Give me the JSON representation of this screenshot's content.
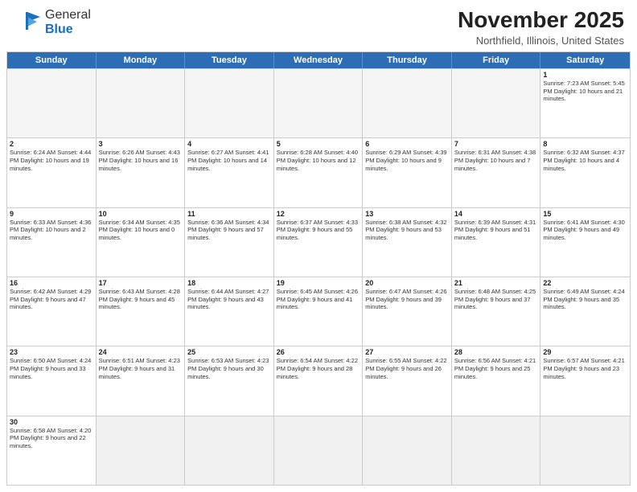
{
  "header": {
    "logo_general": "General",
    "logo_blue": "Blue",
    "month_title": "November 2025",
    "location": "Northfield, Illinois, United States"
  },
  "days_of_week": [
    "Sunday",
    "Monday",
    "Tuesday",
    "Wednesday",
    "Thursday",
    "Friday",
    "Saturday"
  ],
  "weeks": [
    [
      {
        "day": "",
        "info": "",
        "empty": true
      },
      {
        "day": "",
        "info": "",
        "empty": true
      },
      {
        "day": "",
        "info": "",
        "empty": true
      },
      {
        "day": "",
        "info": "",
        "empty": true
      },
      {
        "day": "",
        "info": "",
        "empty": true
      },
      {
        "day": "",
        "info": "",
        "empty": true
      },
      {
        "day": "1",
        "info": "Sunrise: 7:23 AM\nSunset: 5:45 PM\nDaylight: 10 hours and 21 minutes.",
        "empty": false
      }
    ],
    [
      {
        "day": "2",
        "info": "Sunrise: 6:24 AM\nSunset: 4:44 PM\nDaylight: 10 hours and 19 minutes.",
        "empty": false
      },
      {
        "day": "3",
        "info": "Sunrise: 6:26 AM\nSunset: 4:43 PM\nDaylight: 10 hours and 16 minutes.",
        "empty": false
      },
      {
        "day": "4",
        "info": "Sunrise: 6:27 AM\nSunset: 4:41 PM\nDaylight: 10 hours and 14 minutes.",
        "empty": false
      },
      {
        "day": "5",
        "info": "Sunrise: 6:28 AM\nSunset: 4:40 PM\nDaylight: 10 hours and 12 minutes.",
        "empty": false
      },
      {
        "day": "6",
        "info": "Sunrise: 6:29 AM\nSunset: 4:39 PM\nDaylight: 10 hours and 9 minutes.",
        "empty": false
      },
      {
        "day": "7",
        "info": "Sunrise: 6:31 AM\nSunset: 4:38 PM\nDaylight: 10 hours and 7 minutes.",
        "empty": false
      },
      {
        "day": "8",
        "info": "Sunrise: 6:32 AM\nSunset: 4:37 PM\nDaylight: 10 hours and 4 minutes.",
        "empty": false
      }
    ],
    [
      {
        "day": "9",
        "info": "Sunrise: 6:33 AM\nSunset: 4:36 PM\nDaylight: 10 hours and 2 minutes.",
        "empty": false
      },
      {
        "day": "10",
        "info": "Sunrise: 6:34 AM\nSunset: 4:35 PM\nDaylight: 10 hours and 0 minutes.",
        "empty": false
      },
      {
        "day": "11",
        "info": "Sunrise: 6:36 AM\nSunset: 4:34 PM\nDaylight: 9 hours and 57 minutes.",
        "empty": false
      },
      {
        "day": "12",
        "info": "Sunrise: 6:37 AM\nSunset: 4:33 PM\nDaylight: 9 hours and 55 minutes.",
        "empty": false
      },
      {
        "day": "13",
        "info": "Sunrise: 6:38 AM\nSunset: 4:32 PM\nDaylight: 9 hours and 53 minutes.",
        "empty": false
      },
      {
        "day": "14",
        "info": "Sunrise: 6:39 AM\nSunset: 4:31 PM\nDaylight: 9 hours and 51 minutes.",
        "empty": false
      },
      {
        "day": "15",
        "info": "Sunrise: 6:41 AM\nSunset: 4:30 PM\nDaylight: 9 hours and 49 minutes.",
        "empty": false
      }
    ],
    [
      {
        "day": "16",
        "info": "Sunrise: 6:42 AM\nSunset: 4:29 PM\nDaylight: 9 hours and 47 minutes.",
        "empty": false
      },
      {
        "day": "17",
        "info": "Sunrise: 6:43 AM\nSunset: 4:28 PM\nDaylight: 9 hours and 45 minutes.",
        "empty": false
      },
      {
        "day": "18",
        "info": "Sunrise: 6:44 AM\nSunset: 4:27 PM\nDaylight: 9 hours and 43 minutes.",
        "empty": false
      },
      {
        "day": "19",
        "info": "Sunrise: 6:45 AM\nSunset: 4:26 PM\nDaylight: 9 hours and 41 minutes.",
        "empty": false
      },
      {
        "day": "20",
        "info": "Sunrise: 6:47 AM\nSunset: 4:26 PM\nDaylight: 9 hours and 39 minutes.",
        "empty": false
      },
      {
        "day": "21",
        "info": "Sunrise: 6:48 AM\nSunset: 4:25 PM\nDaylight: 9 hours and 37 minutes.",
        "empty": false
      },
      {
        "day": "22",
        "info": "Sunrise: 6:49 AM\nSunset: 4:24 PM\nDaylight: 9 hours and 35 minutes.",
        "empty": false
      }
    ],
    [
      {
        "day": "23",
        "info": "Sunrise: 6:50 AM\nSunset: 4:24 PM\nDaylight: 9 hours and 33 minutes.",
        "empty": false
      },
      {
        "day": "24",
        "info": "Sunrise: 6:51 AM\nSunset: 4:23 PM\nDaylight: 9 hours and 31 minutes.",
        "empty": false
      },
      {
        "day": "25",
        "info": "Sunrise: 6:53 AM\nSunset: 4:23 PM\nDaylight: 9 hours and 30 minutes.",
        "empty": false
      },
      {
        "day": "26",
        "info": "Sunrise: 6:54 AM\nSunset: 4:22 PM\nDaylight: 9 hours and 28 minutes.",
        "empty": false
      },
      {
        "day": "27",
        "info": "Sunrise: 6:55 AM\nSunset: 4:22 PM\nDaylight: 9 hours and 26 minutes.",
        "empty": false
      },
      {
        "day": "28",
        "info": "Sunrise: 6:56 AM\nSunset: 4:21 PM\nDaylight: 9 hours and 25 minutes.",
        "empty": false
      },
      {
        "day": "29",
        "info": "Sunrise: 6:57 AM\nSunset: 4:21 PM\nDaylight: 9 hours and 23 minutes.",
        "empty": false
      }
    ],
    [
      {
        "day": "30",
        "info": "Sunrise: 6:58 AM\nSunset: 4:20 PM\nDaylight: 9 hours and 22 minutes.",
        "empty": false
      },
      {
        "day": "",
        "info": "",
        "empty": true
      },
      {
        "day": "",
        "info": "",
        "empty": true
      },
      {
        "day": "",
        "info": "",
        "empty": true
      },
      {
        "day": "",
        "info": "",
        "empty": true
      },
      {
        "day": "",
        "info": "",
        "empty": true
      },
      {
        "day": "",
        "info": "",
        "empty": true
      }
    ]
  ]
}
